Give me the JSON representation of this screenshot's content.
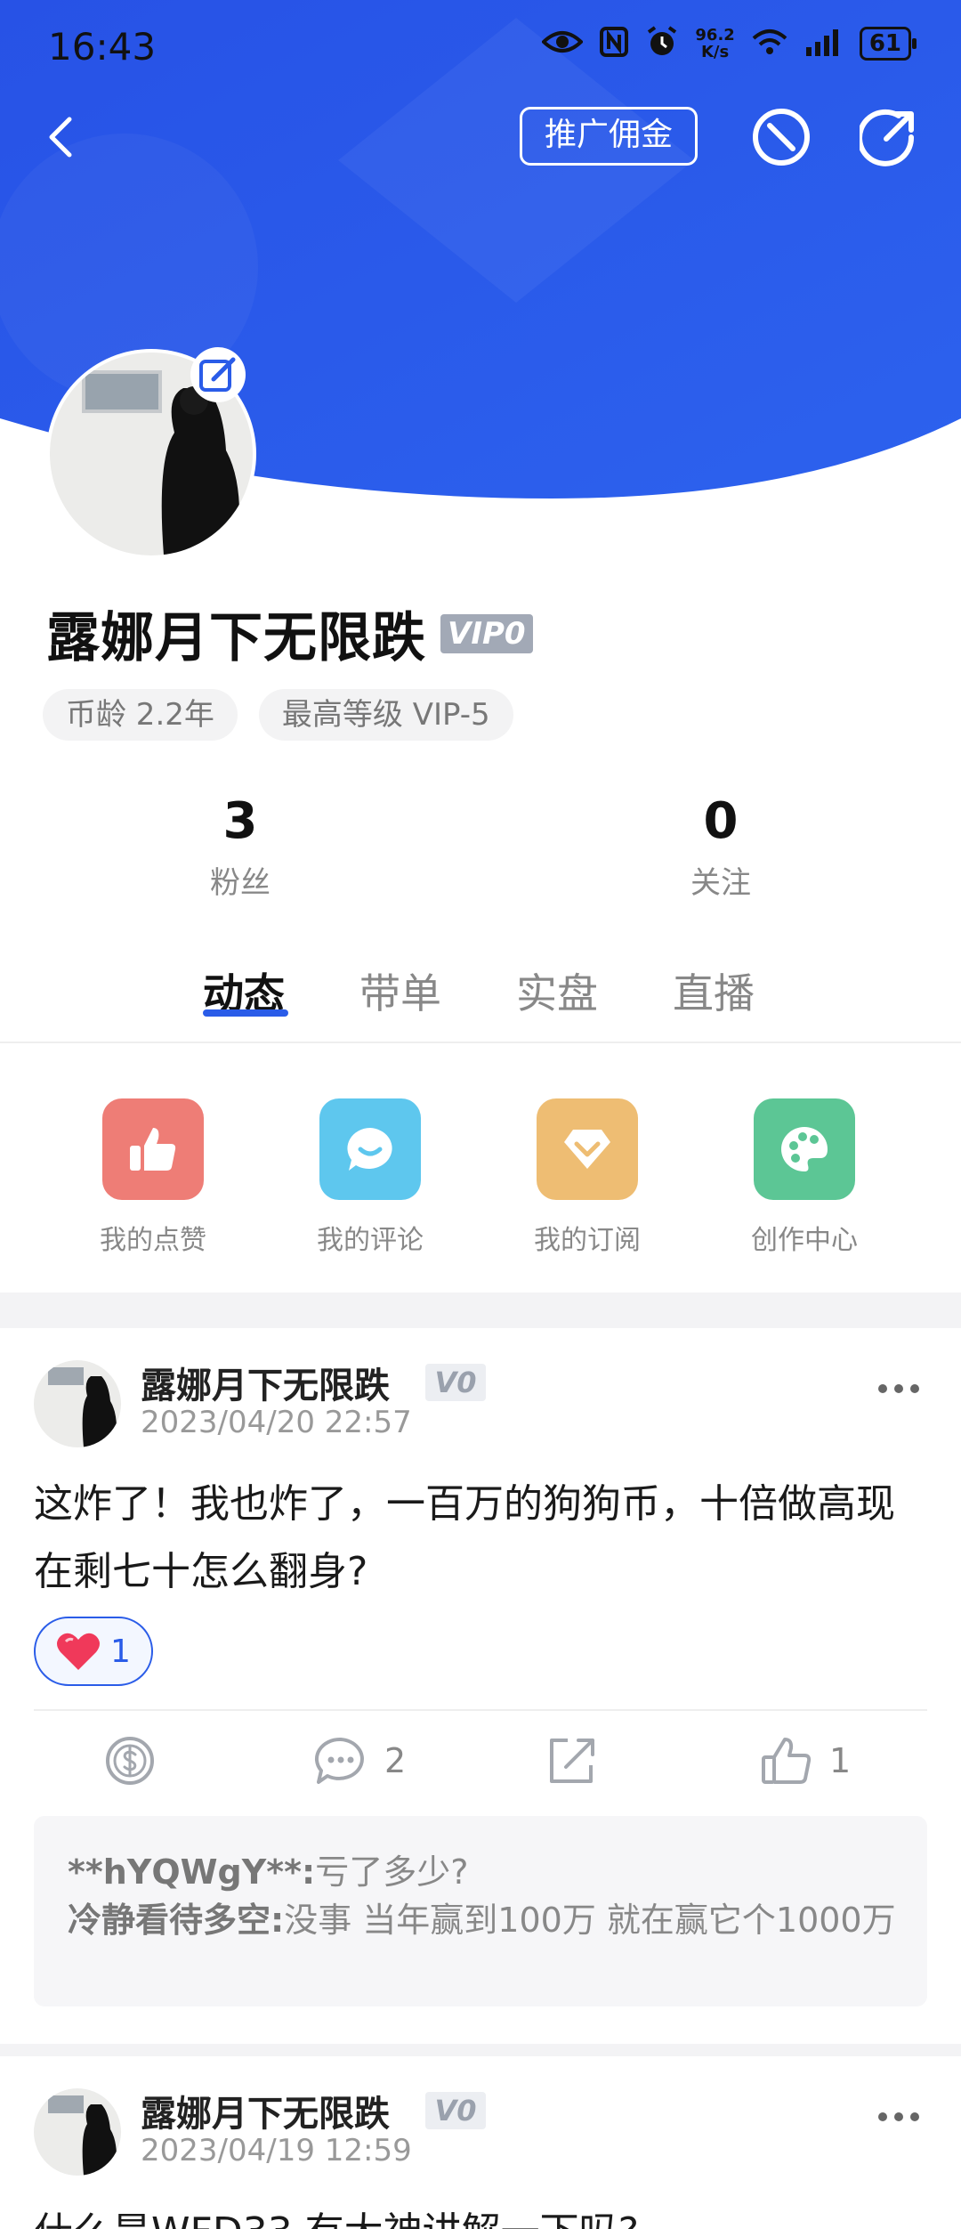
{
  "status_bar": {
    "time": "16:43",
    "net_speed_value": "96.2",
    "net_speed_unit": "K/s",
    "battery": "61"
  },
  "header": {
    "promo_button": "推广佣金",
    "icons": [
      "back-icon",
      "ban-icon",
      "share-icon",
      "edit-icon"
    ],
    "brand_color": "#2a5ce8"
  },
  "profile": {
    "username": "露娜月下无限跌",
    "vip": "VIP0",
    "tags": [
      "币龄 2.2年",
      "最高等级 VIP-5"
    ],
    "stats": [
      {
        "value": "3",
        "label": "粉丝"
      },
      {
        "value": "0",
        "label": "关注"
      }
    ]
  },
  "tabs": [
    "动态",
    "带单",
    "实盘",
    "直播"
  ],
  "quick_actions": [
    {
      "label": "我的点赞",
      "icon": "thumbs-up-icon",
      "color": "#ee7d76"
    },
    {
      "label": "我的评论",
      "icon": "chat-bubble-icon",
      "color": "#5ec7ee"
    },
    {
      "label": "我的订阅",
      "icon": "subscribe-diamond-icon",
      "color": "#eebd73"
    },
    {
      "label": "创作中心",
      "icon": "palette-icon",
      "color": "#5cc695"
    }
  ],
  "posts": [
    {
      "author": "露娜月下无限跌",
      "badge": "V0",
      "time": "2023/04/20 22:57",
      "content": "这炸了！我也炸了，一百万的狗狗币，十倍做高现在剩七十怎么翻身?",
      "reaction_count": "1",
      "comment_count": "2",
      "like_count": "1",
      "comments": [
        {
          "user": "**hYQWgY**:",
          "text": "亏了多少?"
        },
        {
          "user": "冷静看待多空:",
          "text": "没事 当年赢到100万 就在赢它个1000万"
        }
      ]
    },
    {
      "author": "露娜月下无限跌",
      "badge": "V0",
      "time": "2023/04/19 12:59",
      "content": "什么是WFD33 有大神讲解一下吗?"
    }
  ]
}
